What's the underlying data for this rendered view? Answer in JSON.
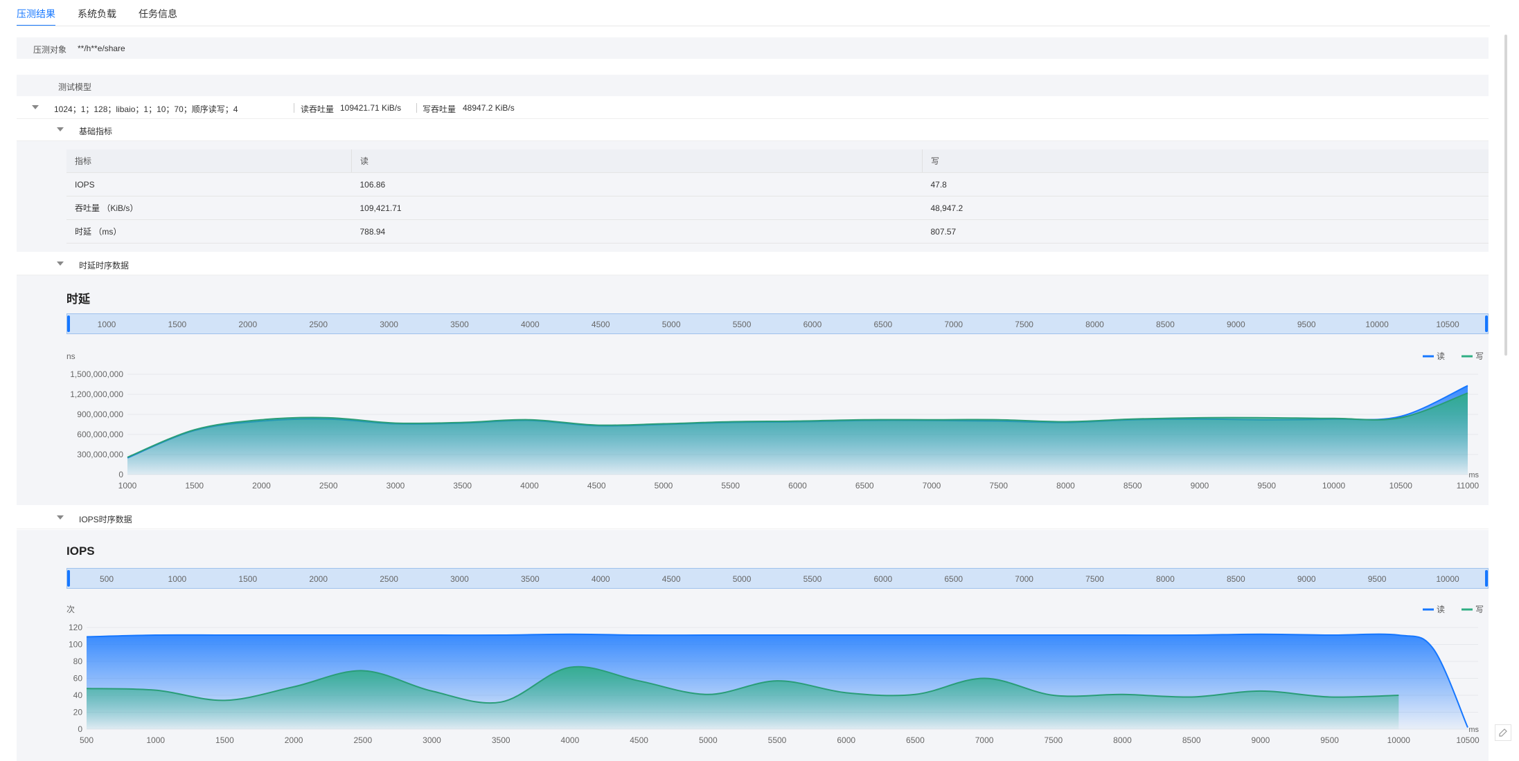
{
  "tabs": [
    "压测结果",
    "系统负载",
    "任务信息"
  ],
  "target": {
    "label": "压测对象",
    "value": "**/h**e/share"
  },
  "model": {
    "header": "测试模型",
    "config": "1024；1；128；libaio；1；10；70；顺序读写；4",
    "read_label": "读吞吐量",
    "read_value": "109421.71 KiB/s",
    "write_label": "写吞吐量",
    "write_value": "48947.2 KiB/s"
  },
  "basic": {
    "title": "基础指标",
    "columns": [
      "指标",
      "读",
      "写"
    ],
    "rows": [
      [
        "IOPS",
        "106.86",
        "47.8"
      ],
      [
        "吞吐量 （KiB/s）",
        "109,421.71",
        "48,947.2"
      ],
      [
        "时延 （ms）",
        "788.94",
        "807.57"
      ]
    ]
  },
  "latency_section": {
    "title": "时延时序数据"
  },
  "iops_section": {
    "title": "IOPS时序数据"
  },
  "colors": {
    "read": "#1677ff",
    "write": "#2fae84",
    "accent": "#1677ff"
  },
  "chart_data": [
    {
      "type": "area",
      "title": "时延",
      "ylabel": "ns",
      "xunit": "ms",
      "xlim": [
        1000,
        11000
      ],
      "ylim": [
        0,
        1500000000
      ],
      "y_ticks": [
        0,
        300000000,
        600000000,
        900000000,
        1200000000,
        1500000000
      ],
      "y_tick_labels": [
        "0",
        "300,000,000",
        "600,000,000",
        "900,000,000",
        "1,200,000,000",
        "1,500,000,000"
      ],
      "x_ticks": [
        "1000",
        "1500",
        "2000",
        "2500",
        "3000",
        "3500",
        "4000",
        "4500",
        "5000",
        "5500",
        "6000",
        "6500",
        "7000",
        "7500",
        "8000",
        "8500",
        "9000",
        "9500",
        "10000",
        "10500",
        "11000"
      ],
      "zoom_ticks": [
        "1000",
        "1500",
        "2000",
        "2500",
        "3000",
        "3500",
        "4000",
        "4500",
        "5000",
        "5500",
        "6000",
        "6500",
        "7000",
        "7500",
        "8000",
        "8500",
        "9000",
        "9500",
        "10000",
        "10500"
      ],
      "legend": [
        "读",
        "写"
      ],
      "grid": true,
      "series": [
        {
          "name": "读",
          "x": [
            1000,
            1500,
            2000,
            2500,
            3000,
            3500,
            4000,
            4500,
            5000,
            5500,
            6000,
            6500,
            7000,
            7500,
            8000,
            8500,
            9000,
            9500,
            10000,
            10500,
            11000
          ],
          "values": [
            250000000,
            660000000,
            800000000,
            830000000,
            760000000,
            770000000,
            810000000,
            730000000,
            750000000,
            780000000,
            790000000,
            810000000,
            810000000,
            800000000,
            780000000,
            820000000,
            830000000,
            820000000,
            830000000,
            870000000,
            1330000000
          ]
        },
        {
          "name": "写",
          "x": [
            1000,
            1500,
            2000,
            2500,
            3000,
            3500,
            4000,
            4500,
            5000,
            5500,
            6000,
            6500,
            7000,
            7500,
            8000,
            8500,
            9000,
            9500,
            10000,
            10500,
            11000
          ],
          "values": [
            260000000,
            670000000,
            820000000,
            850000000,
            770000000,
            780000000,
            820000000,
            740000000,
            760000000,
            790000000,
            800000000,
            820000000,
            820000000,
            820000000,
            790000000,
            830000000,
            850000000,
            850000000,
            840000000,
            850000000,
            1220000000
          ]
        }
      ]
    },
    {
      "type": "area",
      "title": "IOPS",
      "ylabel": "次",
      "xunit": "ms",
      "xlim": [
        500,
        10500
      ],
      "ylim": [
        0,
        120
      ],
      "y_ticks": [
        0,
        20,
        40,
        60,
        80,
        100,
        120
      ],
      "y_tick_labels": [
        "0",
        "20",
        "40",
        "60",
        "80",
        "100",
        "120"
      ],
      "x_ticks": [
        "500",
        "1000",
        "1500",
        "2000",
        "2500",
        "3000",
        "3500",
        "4000",
        "4500",
        "5000",
        "5500",
        "6000",
        "6500",
        "7000",
        "7500",
        "8000",
        "8500",
        "9000",
        "9500",
        "10000",
        "10500"
      ],
      "zoom_ticks": [
        "500",
        "1000",
        "1500",
        "2000",
        "2500",
        "3000",
        "3500",
        "4000",
        "4500",
        "5000",
        "5500",
        "6000",
        "6500",
        "7000",
        "7500",
        "8000",
        "8500",
        "9000",
        "9500",
        "10000"
      ],
      "legend": [
        "读",
        "写"
      ],
      "grid": true,
      "series": [
        {
          "name": "读",
          "x": [
            500,
            1000,
            1500,
            2000,
            2500,
            3000,
            3500,
            4000,
            4500,
            5000,
            5500,
            6000,
            6500,
            7000,
            7500,
            8000,
            8500,
            9000,
            9500,
            10000,
            10250,
            10500
          ],
          "values": [
            109,
            111,
            111,
            111,
            111,
            111,
            111,
            112,
            111,
            111,
            111,
            111,
            111,
            111,
            111,
            111,
            111,
            112,
            111,
            111,
            95,
            2
          ]
        },
        {
          "name": "写",
          "x": [
            500,
            1000,
            1500,
            2000,
            2500,
            3000,
            3500,
            4000,
            4500,
            5000,
            5500,
            6000,
            6500,
            7000,
            7500,
            8000,
            8500,
            9000,
            9500,
            10000
          ],
          "values": [
            48,
            46,
            34,
            50,
            69,
            45,
            32,
            73,
            57,
            41,
            57,
            43,
            41,
            60,
            40,
            41,
            38,
            45,
            38,
            40
          ]
        }
      ]
    }
  ]
}
